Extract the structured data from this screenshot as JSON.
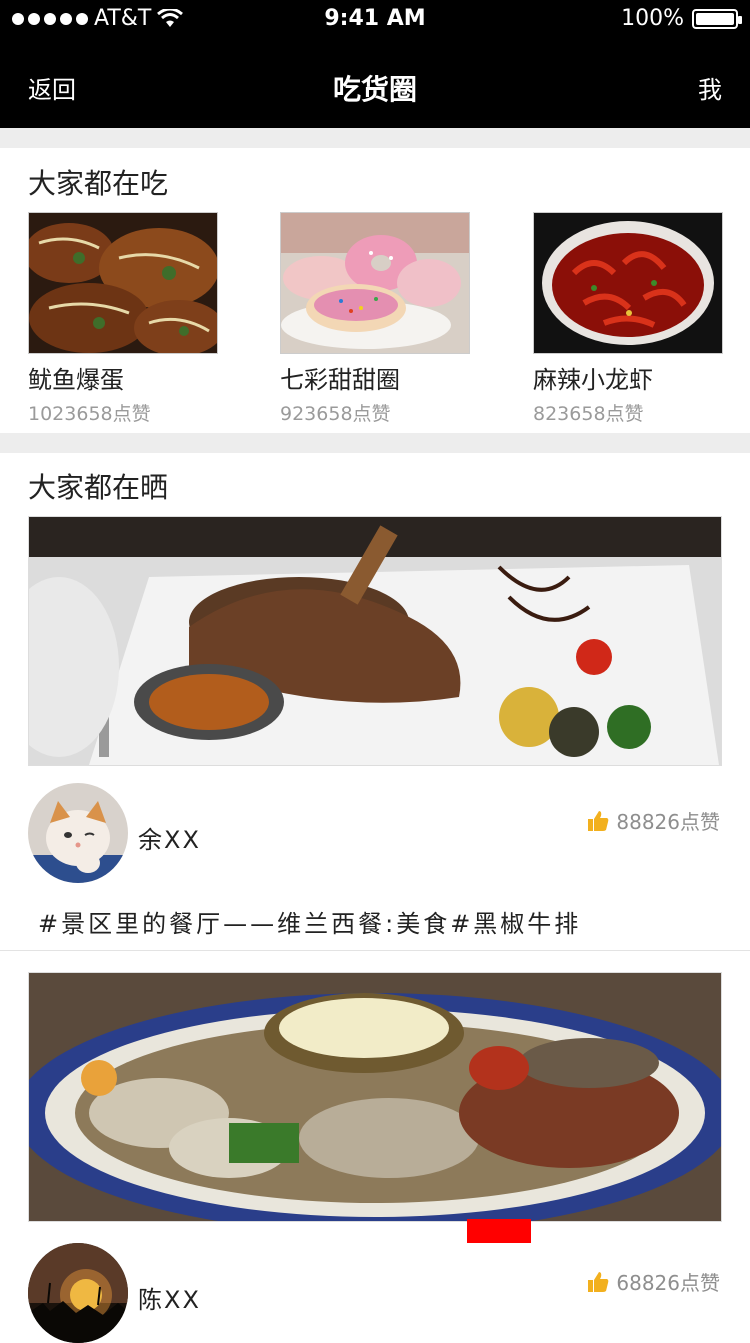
{
  "status": {
    "carrier": "AT&T",
    "time": "9:41 AM",
    "battery": "100%"
  },
  "nav": {
    "back_label": "返回",
    "title": "吃货圈",
    "me_label": "我"
  },
  "popular": {
    "title": "大家都在吃",
    "items": [
      {
        "name": "鱿鱼爆蛋",
        "likes": "1023658点赞"
      },
      {
        "name": "七彩甜甜圈",
        "likes": "923658点赞"
      },
      {
        "name": "麻辣小龙虾",
        "likes": "823658点赞"
      }
    ]
  },
  "feed": {
    "title": "大家都在晒",
    "posts": [
      {
        "author": "余XX",
        "likes": "88826点赞",
        "text": "#景区里的餐厅——维兰西餐:美食#黑椒牛排"
      },
      {
        "author": "陈XX",
        "likes": "68826点赞"
      }
    ]
  },
  "icons": {
    "like": "thumbs-up-icon",
    "signal": "signal-dots-icon",
    "wifi": "wifi-icon",
    "battery": "battery-icon"
  },
  "colors": {
    "nav_bg": "#000000",
    "like_icon": "#f2b01e",
    "divider": "#ededed",
    "marker": "#ff0000"
  }
}
